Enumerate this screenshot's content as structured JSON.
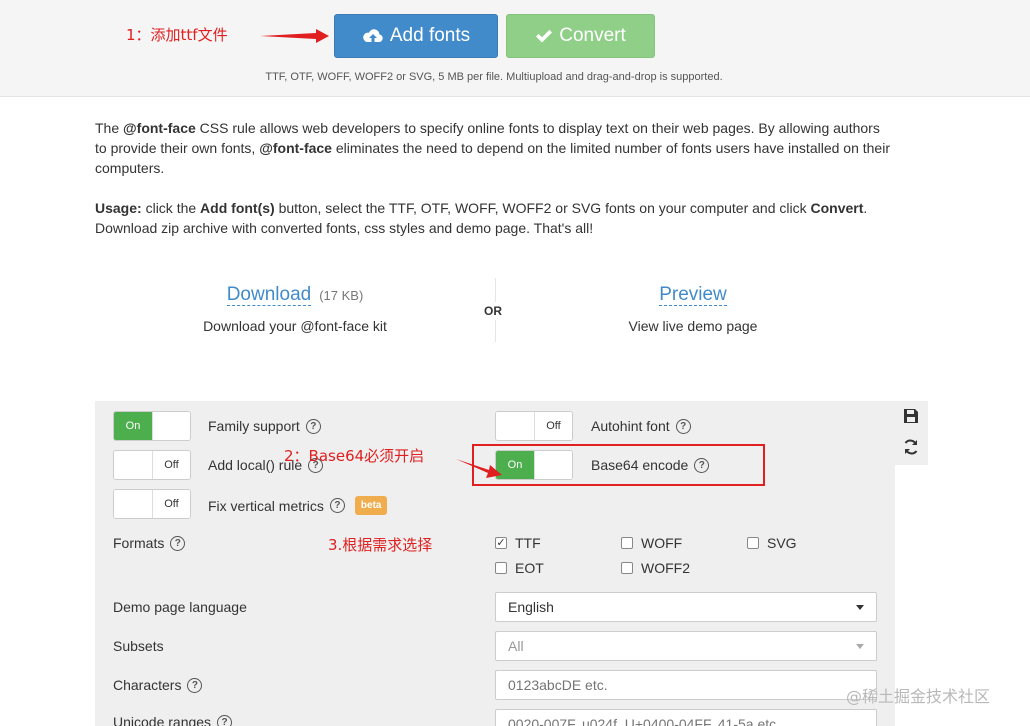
{
  "toolbar": {
    "add_label": "Add fonts",
    "convert_label": "Convert",
    "upload_note": "TTF, OTF, WOFF, WOFF2 or SVG, 5 MB per file. Multiupload and drag-and-drop is supported."
  },
  "annotations": {
    "step1": "1：添加ttf文件",
    "step2": "2：Base64必须开启",
    "step3": "3.根据需求选择",
    "color": "#e02020"
  },
  "intro": {
    "p1_a": "The ",
    "p1_b": "@font-face",
    "p1_c": " CSS rule allows web developers to specify online fonts to display text on their web pages. By allowing authors to provide their own fonts, ",
    "p1_d": "@font-face",
    "p1_e": " eliminates the need to depend on the limited number of fonts users have installed on their computers.",
    "p2_a": "Usage:",
    "p2_b": " click the ",
    "p2_c": "Add font(s)",
    "p2_d": " button, select the TTF, OTF, WOFF, WOFF2 or SVG fonts on your computer and click ",
    "p2_e": "Convert",
    "p2_f": ". Download zip archive with converted fonts, css styles and demo page. That's all!"
  },
  "download": {
    "link": "Download",
    "size": "(17 KB)",
    "sub": "Download your @font-face kit",
    "or": "OR",
    "preview_link": "Preview",
    "preview_sub": "View live demo page"
  },
  "options": {
    "family_support": {
      "label": "Family support",
      "state": "On"
    },
    "add_local": {
      "label": "Add local() rule",
      "state": "Off"
    },
    "fix_vertical": {
      "label": "Fix vertical metrics",
      "state": "Off",
      "badge": "beta"
    },
    "autohint": {
      "label": "Autohint font",
      "state": "Off"
    },
    "base64": {
      "label": "Base64 encode",
      "state": "On"
    }
  },
  "formats": {
    "label": "Formats",
    "items": [
      {
        "name": "TTF",
        "checked": true
      },
      {
        "name": "WOFF",
        "checked": false
      },
      {
        "name": "SVG",
        "checked": false
      },
      {
        "name": "EOT",
        "checked": false
      },
      {
        "name": "WOFF2",
        "checked": false
      }
    ]
  },
  "demo_language": {
    "label": "Demo page language",
    "value": "English"
  },
  "subsets": {
    "label": "Subsets",
    "value": "All"
  },
  "characters": {
    "label": "Characters",
    "placeholder": "0123abcDE etc."
  },
  "unicode_ranges": {
    "label": "Unicode ranges",
    "placeholder": "0020-007F, u024f, U+0400-04FF, 41-5a etc."
  },
  "watermark": "@稀土掘金技术社区",
  "colors": {
    "primary": "#428bca",
    "success": "#8fcf87",
    "toggle_on": "#4cae4c",
    "beta": "#f0ad4e"
  }
}
